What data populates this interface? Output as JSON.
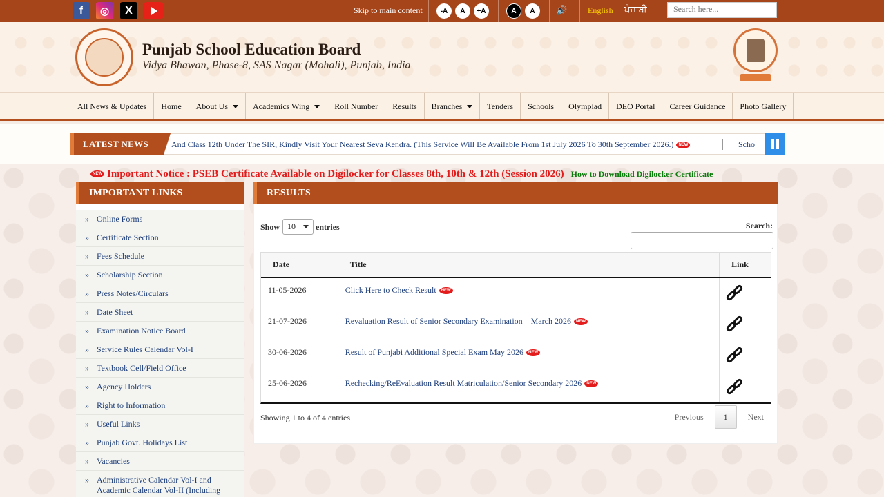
{
  "topbar": {
    "skip_link": "Skip to main content",
    "font_buttons": [
      "-A",
      "A",
      "+A"
    ],
    "contrast_buttons": [
      "A",
      "A"
    ],
    "lang_en": "English",
    "lang_pa": "ਪੰਜਾਬੀ",
    "search_placeholder": "Search here...",
    "social_icons": [
      "facebook-icon",
      "instagram-icon",
      "x-icon",
      "youtube-icon"
    ]
  },
  "header": {
    "title": "Punjab School Education Board",
    "subtitle": "Vidya Bhawan, Phase-8, SAS Nagar (Mohali), Punjab, India"
  },
  "nav": {
    "items": [
      {
        "label": "All News & Updates",
        "dropdown": false
      },
      {
        "label": "Home",
        "dropdown": false
      },
      {
        "label": "About Us",
        "dropdown": true
      },
      {
        "label": "Academics Wing",
        "dropdown": true
      },
      {
        "label": "Roll Number",
        "dropdown": false
      },
      {
        "label": "Results",
        "dropdown": false
      },
      {
        "label": "Branches",
        "dropdown": true
      },
      {
        "label": "Tenders",
        "dropdown": false
      },
      {
        "label": "Schools",
        "dropdown": false
      },
      {
        "label": "Olympiad",
        "dropdown": false
      },
      {
        "label": "DEO Portal",
        "dropdown": false
      },
      {
        "label": "Career Guidance",
        "dropdown": false
      },
      {
        "label": "Photo Gallery",
        "dropdown": false
      }
    ]
  },
  "ticker": {
    "label": "LATEST NEWS",
    "text": "And Class 12th Under The SIR, Kindly Visit Your Nearest Seva Kendra. (This Service Will Be Available From 1st July 2026 To 30th September 2026.)",
    "text_next": "Scho"
  },
  "notice": {
    "text": "Important Notice : PSEB Certificate Available on Digilocker for Classes 8th, 10th & 12th (Session 2026)",
    "link": "How to Download Digilocker Certificate"
  },
  "new_badge": "NEW",
  "sidebar": {
    "heading": "IMPORTANT LINKS",
    "bullet": "»",
    "links": [
      "Online Forms",
      "Certificate Section",
      "Fees Schedule",
      "Scholarship Section",
      "Press Notes/Circulars",
      "Date Sheet",
      "Examination Notice Board",
      "Service Rules Calendar Vol-I",
      "Textbook Cell/Field Office",
      "Agency Holders",
      "Right to Information",
      "Useful Links",
      "Punjab Govt. Holidays List",
      "Vacancies",
      "Administrative Calendar Vol-I and Academic Calendar Vol-II (Including issued"
    ]
  },
  "results": {
    "heading": "RESULTS",
    "show_label": "Show",
    "entries_value": "10",
    "entries_label": "entries",
    "search_label": "Search:",
    "columns": [
      "Date",
      "Title",
      "Link"
    ],
    "rows": [
      {
        "date": "11-05-2026",
        "title": "Click Here to Check Result"
      },
      {
        "date": "21-07-2026",
        "title": "Revaluation Result of Senior Secondary Examination – March 2026"
      },
      {
        "date": "30-06-2026",
        "title": "Result of Punjabi Additional Special Exam May 2026"
      },
      {
        "date": "25-06-2026",
        "title": "Rechecking/ReEvaluation Result Matriculation/Senior Secondary 2026"
      }
    ],
    "showing": "Showing 1 to 4 of 4 entries",
    "pager": {
      "previous": "Previous",
      "current": "1",
      "next": "Next"
    }
  },
  "colors": {
    "brand_brown": "#b24d1d",
    "topbar": "#a6441a",
    "accent_orange": "#e07b3a",
    "link_blue": "#1f3f7a",
    "notice_red": "#e31b1b",
    "notice_green": "#0a7a0a",
    "pause_blue": "#2f8fe8"
  }
}
